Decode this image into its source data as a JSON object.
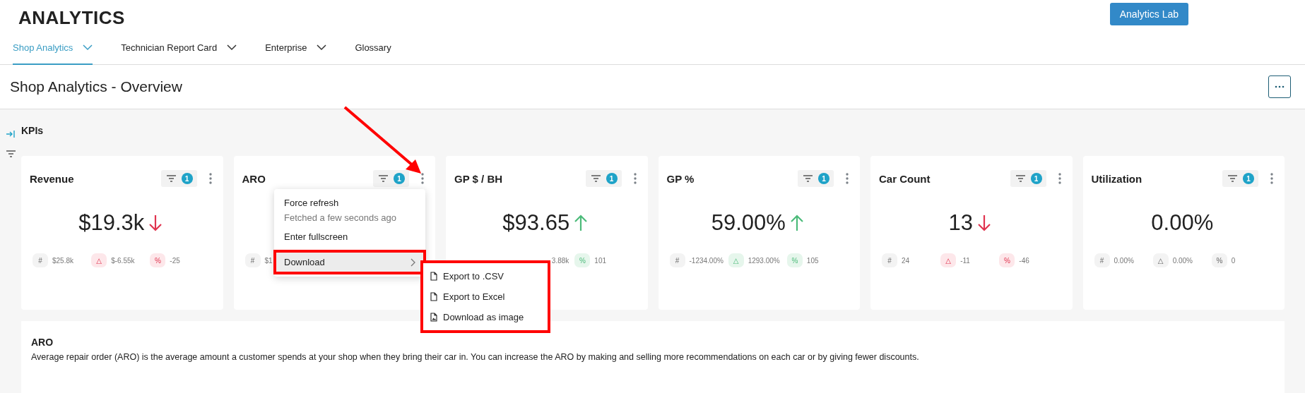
{
  "app_title": "ANALYTICS",
  "lab_button": "Analytics Lab",
  "tabs": [
    {
      "label": "Shop Analytics",
      "dropdown": true,
      "selected": true
    },
    {
      "label": "Technician Report Card",
      "dropdown": true,
      "selected": false
    },
    {
      "label": "Enterprise",
      "dropdown": true,
      "selected": false
    },
    {
      "label": "Glossary",
      "dropdown": false,
      "selected": false
    }
  ],
  "page_title": "Shop Analytics - Overview",
  "section_title": "KPIs",
  "cards": [
    {
      "title": "Revenue",
      "filter_count": "1",
      "value": "$19.3k",
      "kind": "down",
      "pills": [
        {
          "symbol": "#",
          "color": "#f3f3f3",
          "text": "$25.8k"
        },
        {
          "symbol": "△",
          "color": "#fde7ea",
          "text": "$-6.55k"
        },
        {
          "symbol": "%",
          "color": "#fde7ea",
          "text": "-25"
        }
      ]
    },
    {
      "title": "ARO",
      "filter_count": "1",
      "pills": [
        {
          "symbol": "#",
          "color": "#f3f3f3",
          "text": "$1"
        }
      ]
    },
    {
      "title": "GP $ / BH",
      "filter_count": "1",
      "value": "$93.65",
      "kind": "up",
      "pills": [
        {
          "text": "3.88k"
        },
        {
          "symbol": "%",
          "color": "#e6f6ec",
          "text": "101"
        }
      ]
    },
    {
      "title": "GP %",
      "filter_count": "1",
      "value": "59.00%",
      "kind": "up",
      "pills": [
        {
          "symbol": "#",
          "color": "#f3f3f3",
          "text": "-1234.00%"
        },
        {
          "symbol": "△",
          "color": "#e6f6ec",
          "text": "1293.00%"
        },
        {
          "symbol": "%",
          "color": "#e6f6ec",
          "text": "105"
        }
      ]
    },
    {
      "title": "Car Count",
      "filter_count": "1",
      "value": "13",
      "kind": "down",
      "pills": [
        {
          "symbol": "#",
          "color": "#f3f3f3",
          "text": "24"
        },
        {
          "symbol": "△",
          "color": "#fde7ea",
          "text": "-11"
        },
        {
          "symbol": "%",
          "color": "#fde7ea",
          "text": "-46"
        }
      ]
    },
    {
      "title": "Utilization",
      "filter_count": "1",
      "value": "0.00%",
      "pills": [
        {
          "symbol": "#",
          "color": "#f3f3f3",
          "text": "0.00%"
        },
        {
          "symbol": "△",
          "color": "#f3f3f3",
          "text": "0.00%"
        },
        {
          "symbol": "%",
          "color": "#f3f3f3",
          "text": "0"
        }
      ]
    }
  ],
  "menu": {
    "items": [
      {
        "kind": "action",
        "label": "Force refresh",
        "note": "Fetched a few seconds ago",
        "selected": false
      },
      {
        "kind": "action",
        "label": "Enter fullscreen",
        "selected": false
      },
      {
        "kind": "submenu",
        "label": "Download",
        "selected": true
      }
    ],
    "submenu": [
      {
        "kind": "file",
        "label": "Export to .CSV"
      },
      {
        "kind": "file",
        "label": "Export to Excel"
      },
      {
        "kind": "image",
        "label": "Download as image"
      }
    ]
  },
  "description": {
    "title": "ARO",
    "text": "Average repair order (ARO) is the average amount a customer spends at your shop when they bring their car in. You can increase the ARO by making and selling more recommendations on each car or by giving fewer discounts."
  }
}
